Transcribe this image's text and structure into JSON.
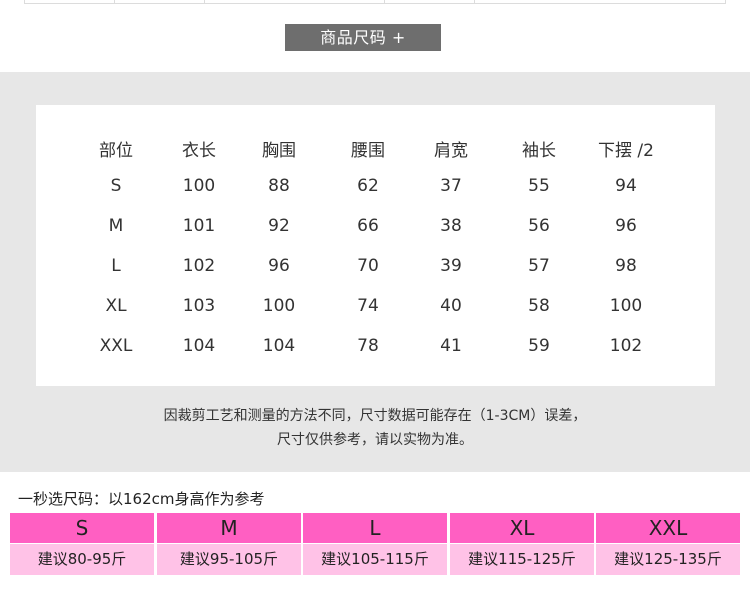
{
  "banner": {
    "label": "商品尺码 +"
  },
  "size_chart": {
    "headers": [
      "部位",
      "衣长",
      "胸围",
      "腰围",
      "肩宽",
      "袖长",
      "下摆 /2"
    ],
    "rows": [
      [
        "S",
        "100",
        "88",
        "62",
        "37",
        "55",
        "94"
      ],
      [
        "M",
        "101",
        "92",
        "66",
        "38",
        "56",
        "96"
      ],
      [
        "L",
        "102",
        "96",
        "70",
        "39",
        "57",
        "98"
      ],
      [
        "XL",
        "103",
        "100",
        "74",
        "40",
        "58",
        "100"
      ],
      [
        "XXL",
        "104",
        "104",
        "78",
        "41",
        "59",
        "102"
      ]
    ]
  },
  "note": {
    "line1": "因裁剪工艺和测量的方法不同，尺寸数据可能存在（1-3CM）误差，",
    "line2": "尺寸仅供参考，请以实物为准。"
  },
  "quick_select": {
    "title": "一秒选尺码：以162cm身高作为参考",
    "items": [
      {
        "size": "S",
        "weight": "建议80-95斤"
      },
      {
        "size": "M",
        "weight": "建议95-105斤"
      },
      {
        "size": "L",
        "weight": "建议105-115斤"
      },
      {
        "size": "XL",
        "weight": "建议115-125斤"
      },
      {
        "size": "XXL",
        "weight": "建议125-135斤"
      }
    ]
  },
  "colors": {
    "banner_bg": "#6e6e6e",
    "panel_bg": "#e7e7e7",
    "size_pink": "#ff5fc2",
    "weight_pink": "#ffc2e7"
  }
}
